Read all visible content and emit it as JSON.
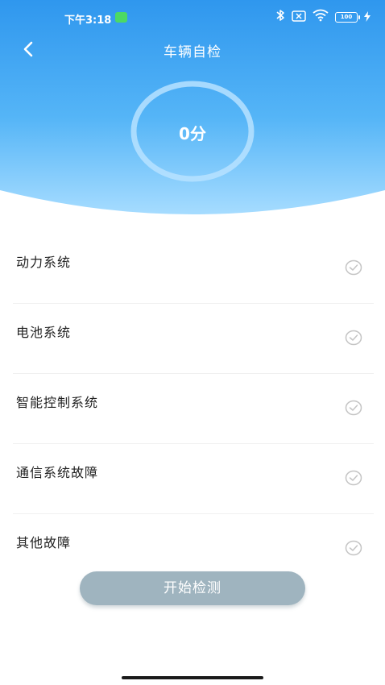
{
  "status_bar": {
    "time": "下午3:18",
    "battery": "100"
  },
  "header": {
    "title": "车辆自检",
    "back_icon": "chevron-left-icon"
  },
  "score": {
    "value": "0分"
  },
  "check_items": [
    {
      "label": "动力系统",
      "icon": "check-circle-icon"
    },
    {
      "label": "电池系统",
      "icon": "check-circle-icon"
    },
    {
      "label": "智能控制系统",
      "icon": "check-circle-icon"
    },
    {
      "label": "通信系统故障",
      "icon": "check-circle-icon"
    },
    {
      "label": "其他故障",
      "icon": "check-circle-icon"
    }
  ],
  "start_button": {
    "label": "开始检测"
  },
  "colors": {
    "header_top": "#2f97ee",
    "header_bottom": "#8fd2ff",
    "button_bg": "#9fb4bf",
    "check_icon": "#c4c4c4"
  }
}
